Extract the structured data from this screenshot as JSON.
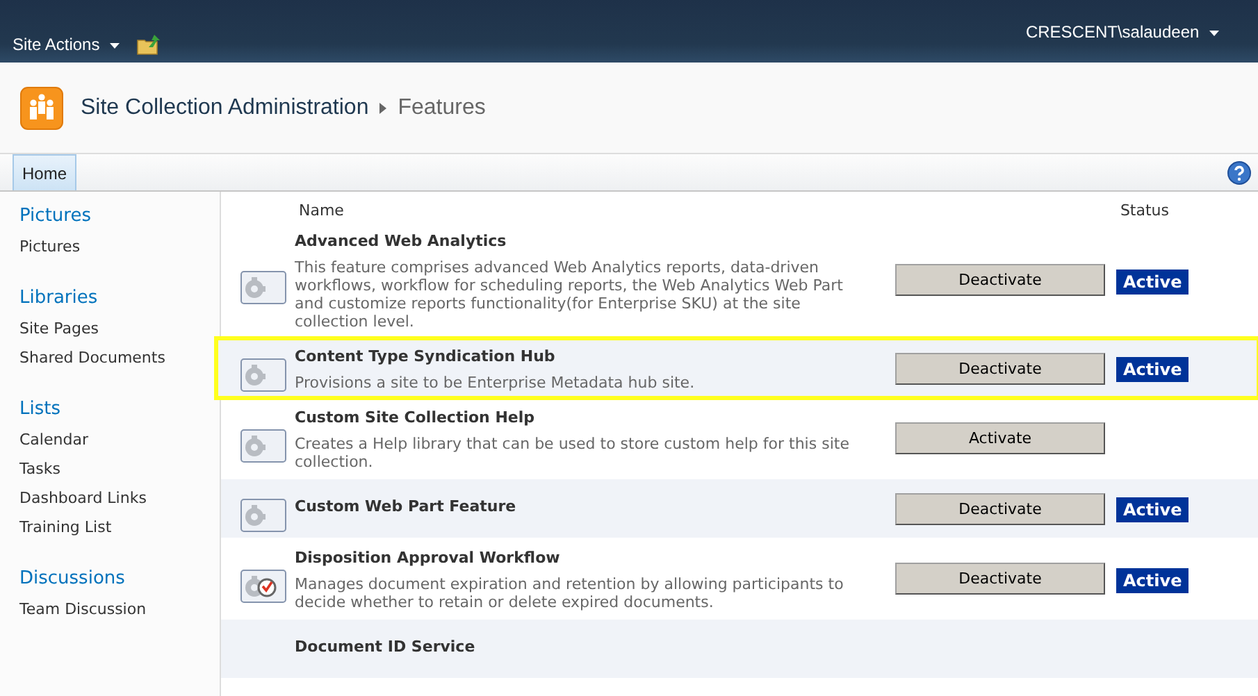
{
  "top_bar": {
    "site_actions": "Site Actions",
    "user": "CRESCENT\\salaudeen"
  },
  "title": {
    "site": "Site Collection Administration",
    "page": "Features"
  },
  "ribbon": {
    "tabs": [
      {
        "label": "Home",
        "selected": true
      }
    ]
  },
  "sidebar": {
    "groups": [
      {
        "heading": "Pictures",
        "items": [
          "Pictures"
        ]
      },
      {
        "heading": "Libraries",
        "items": [
          "Site Pages",
          "Shared Documents"
        ]
      },
      {
        "heading": "Lists",
        "items": [
          "Calendar",
          "Tasks",
          "Dashboard Links",
          "Training List"
        ]
      },
      {
        "heading": "Discussions",
        "items": [
          "Team Discussion"
        ]
      }
    ]
  },
  "table": {
    "columns": [
      "Name",
      "Status"
    ],
    "rows": [
      {
        "name": "Advanced Web Analytics",
        "description": "This feature comprises advanced Web Analytics reports, data-driven workflows, workflow for scheduling reports, the Web Analytics Web Part and customize reports functionality(for Enterprise SKU) at the site collection level.",
        "kind": "gear",
        "action": "Deactivate",
        "status": "Active",
        "shaded": false,
        "highlighted": false
      },
      {
        "name": "Content Type Syndication Hub",
        "description": "Provisions a site to be Enterprise Metadata hub site.",
        "kind": "gear",
        "action": "Deactivate",
        "status": "Active",
        "shaded": true,
        "highlighted": true
      },
      {
        "name": "Custom Site Collection Help",
        "description": "Creates a Help library that can be used to store custom help for this site collection.",
        "kind": "gear",
        "action": "Activate",
        "shaded": false,
        "highlighted": false
      },
      {
        "name": "Custom Web Part Feature",
        "kind": "gear",
        "action": "Deactivate",
        "status": "Active",
        "shaded": true,
        "highlighted": false
      },
      {
        "name": "Disposition Approval Workflow",
        "description": "Manages document expiration and retention by allowing participants to decide whether to retain or delete expired documents.",
        "kind": "approval",
        "action": "Deactivate",
        "status": "Active",
        "shaded": false,
        "highlighted": false
      },
      {
        "name": "Document ID Service",
        "kind": "partial",
        "shaded": true,
        "highlighted": false
      }
    ]
  }
}
